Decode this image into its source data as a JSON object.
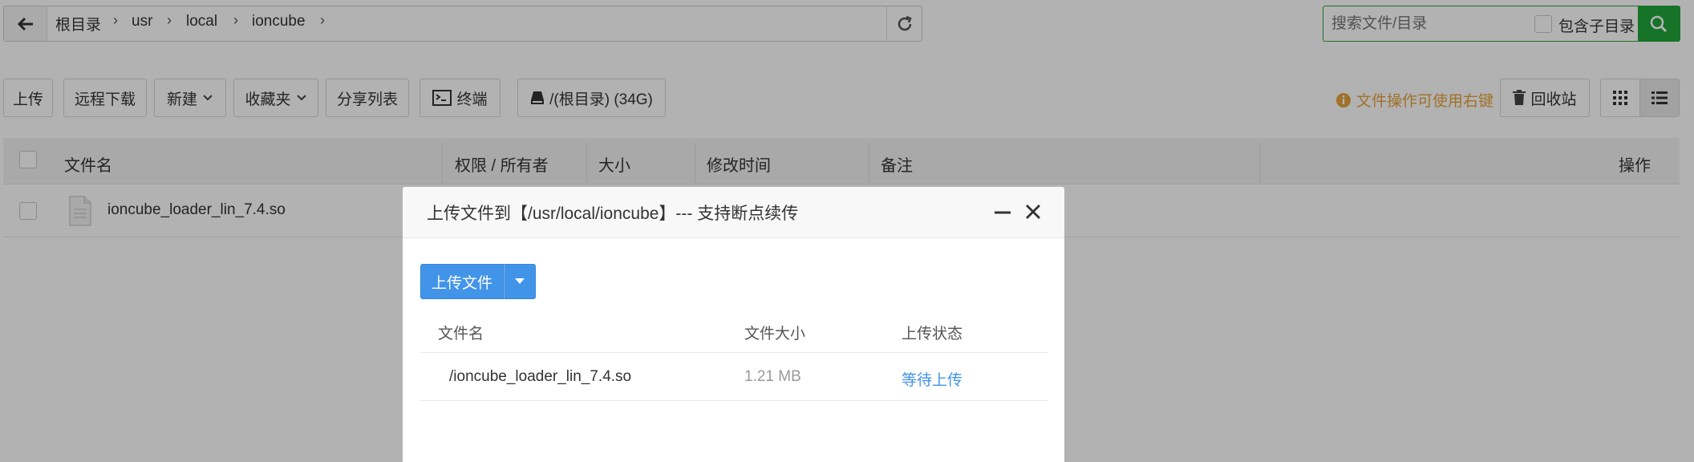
{
  "nav": {
    "back_icon": "arrow-left-icon",
    "breadcrumb": [
      "根目录",
      "usr",
      "local",
      "ioncube"
    ],
    "refresh_icon": "refresh-icon"
  },
  "search": {
    "placeholder": "搜索文件/目录",
    "include_sub_label": "包含子目录",
    "include_sub_checked": false,
    "search_icon": "search-icon",
    "accent": "#20a53a"
  },
  "toolbar": {
    "upload": "上传",
    "remote_download": "远程下载",
    "new": "新建",
    "favorites": "收藏夹",
    "share_list": "分享列表",
    "terminal": "终端",
    "disk": "/(根目录) (34G)",
    "hint": "文件操作可使用右键",
    "recycle": "回收站",
    "hint_color": "#e6a23c"
  },
  "table": {
    "headers": {
      "name": "文件名",
      "perm": "权限 / 所有者",
      "size": "大小",
      "mtime": "修改时间",
      "note": "备注",
      "ops": "操作"
    },
    "rows": [
      {
        "name": "ioncube_loader_lin_7.4.so"
      }
    ]
  },
  "modal": {
    "title": "上传文件到【/usr/local/ioncube】--- 支持断点续传",
    "upload_button": "上传文件",
    "headers": {
      "name": "文件名",
      "size": "文件大小",
      "status": "上传状态"
    },
    "files": [
      {
        "name": "/ioncube_loader_lin_7.4.so",
        "size": "1.21 MB",
        "status": "等待上传"
      }
    ],
    "accent": "#4294e8"
  }
}
